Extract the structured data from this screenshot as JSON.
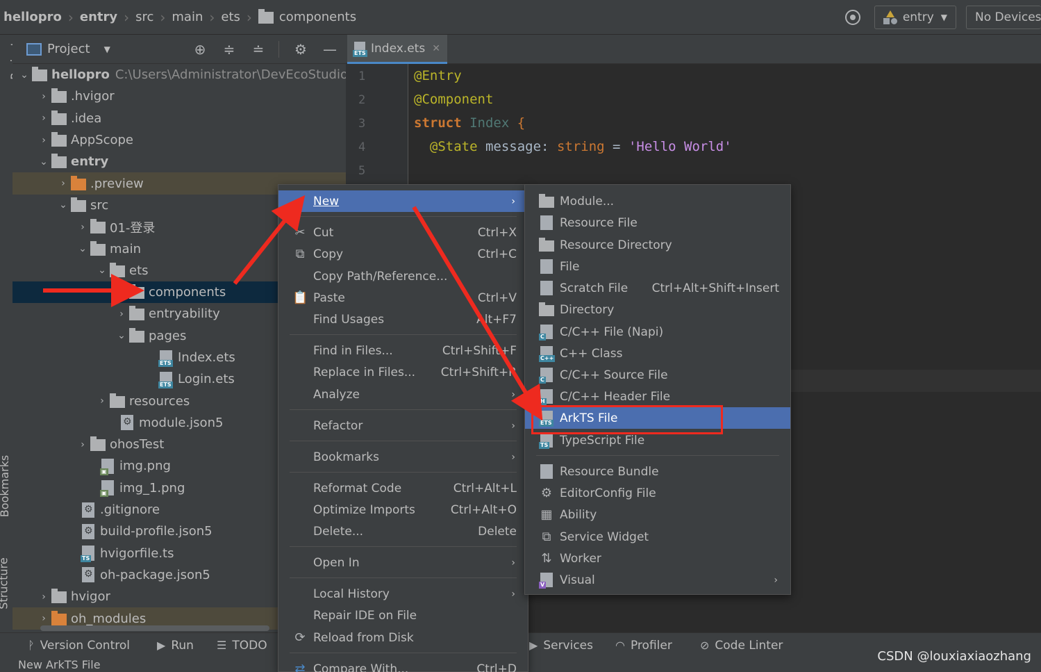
{
  "breadcrumb": {
    "items": [
      "hellopro",
      "entry",
      "src",
      "main",
      "ets",
      "components"
    ]
  },
  "toolbar": {
    "run_config": "entry",
    "device": "No Devices"
  },
  "side_tabs": {
    "project": "Project",
    "bookmarks": "Bookmarks",
    "structure": "Structure"
  },
  "project_panel": {
    "title": "Project",
    "root_name": "hellopro",
    "root_path": "C:\\Users\\Administrator\\DevEcoStudioPro",
    "tree": [
      {
        "label": ".hvigor"
      },
      {
        "label": ".idea"
      },
      {
        "label": "AppScope"
      },
      {
        "label": "entry"
      },
      {
        "label": ".preview"
      },
      {
        "label": "src"
      },
      {
        "label": "01-登录"
      },
      {
        "label": "main"
      },
      {
        "label": "ets"
      },
      {
        "label": "components"
      },
      {
        "label": "entryability"
      },
      {
        "label": "pages"
      },
      {
        "label": "Index.ets"
      },
      {
        "label": "Login.ets"
      },
      {
        "label": "resources"
      },
      {
        "label": "module.json5"
      },
      {
        "label": "ohosTest"
      },
      {
        "label": "img.png"
      },
      {
        "label": "img_1.png"
      },
      {
        "label": ".gitignore"
      },
      {
        "label": "build-profile.json5"
      },
      {
        "label": "hvigorfile.ts"
      },
      {
        "label": "oh-package.json5"
      },
      {
        "label": "hvigor"
      },
      {
        "label": "oh_modules"
      }
    ]
  },
  "editor": {
    "tab_label": "Index.ets",
    "line_numbers": [
      "1",
      "2",
      "3",
      "4",
      "5"
    ],
    "code": {
      "l1": "@Entry",
      "l2": "@Component",
      "l3_kw": "struct",
      "l3_name": "Index",
      "l3_brace": "{",
      "l4_ann": "@State",
      "l4_var": "message:",
      "l4_type": "string",
      "l4_eq": "=",
      "l4_str": "'Hello World'"
    }
  },
  "context_menu": {
    "new": "New",
    "cut": "Cut",
    "cut_sc": "Ctrl+X",
    "copy": "Copy",
    "copy_sc": "Ctrl+C",
    "copy_path": "Copy Path/Reference...",
    "paste": "Paste",
    "paste_sc": "Ctrl+V",
    "find_usages": "Find Usages",
    "find_usages_sc": "Alt+F7",
    "find_in_files": "Find in Files...",
    "find_in_files_sc": "Ctrl+Shift+F",
    "replace_in_files": "Replace in Files...",
    "replace_in_files_sc": "Ctrl+Shift+R",
    "analyze": "Analyze",
    "refactor": "Refactor",
    "bookmarks": "Bookmarks",
    "reformat_code": "Reformat Code",
    "reformat_code_sc": "Ctrl+Alt+L",
    "optimize_imports": "Optimize Imports",
    "optimize_imports_sc": "Ctrl+Alt+O",
    "delete": "Delete...",
    "delete_sc": "Delete",
    "open_in": "Open In",
    "local_history": "Local History",
    "repair_ide": "Repair IDE on File",
    "reload_from_disk": "Reload from Disk",
    "compare_with": "Compare With...",
    "compare_with_sc": "Ctrl+D"
  },
  "new_submenu": {
    "module": "Module...",
    "resource_file": "Resource File",
    "resource_directory": "Resource Directory",
    "file": "File",
    "scratch_file": "Scratch File",
    "scratch_file_sc": "Ctrl+Alt+Shift+Insert",
    "directory": "Directory",
    "cpp_file_napi": "C/C++ File (Napi)",
    "cpp_class": "C++ Class",
    "cpp_source": "C/C++ Source File",
    "cpp_header": "C/C++ Header File",
    "arkts_file": "ArkTS File",
    "typescript_file": "TypeScript File",
    "resource_bundle": "Resource Bundle",
    "editorconfig_file": "EditorConfig File",
    "ability": "Ability",
    "service_widget": "Service Widget",
    "worker": "Worker",
    "visual": "Visual"
  },
  "bottom_bar": {
    "version_control": "Version Control",
    "run": "Run",
    "todo": "TODO",
    "services": "Services",
    "profiler": "Profiler",
    "code_linter": "Code Linter"
  },
  "status": {
    "text": "New ArkTS File"
  },
  "watermark": "CSDN @louxiaxiaozhang",
  "colors": {
    "selection": "#0d293e",
    "menu_highlight": "#4b6eaf",
    "annotation_red": "#ee2a1f"
  }
}
